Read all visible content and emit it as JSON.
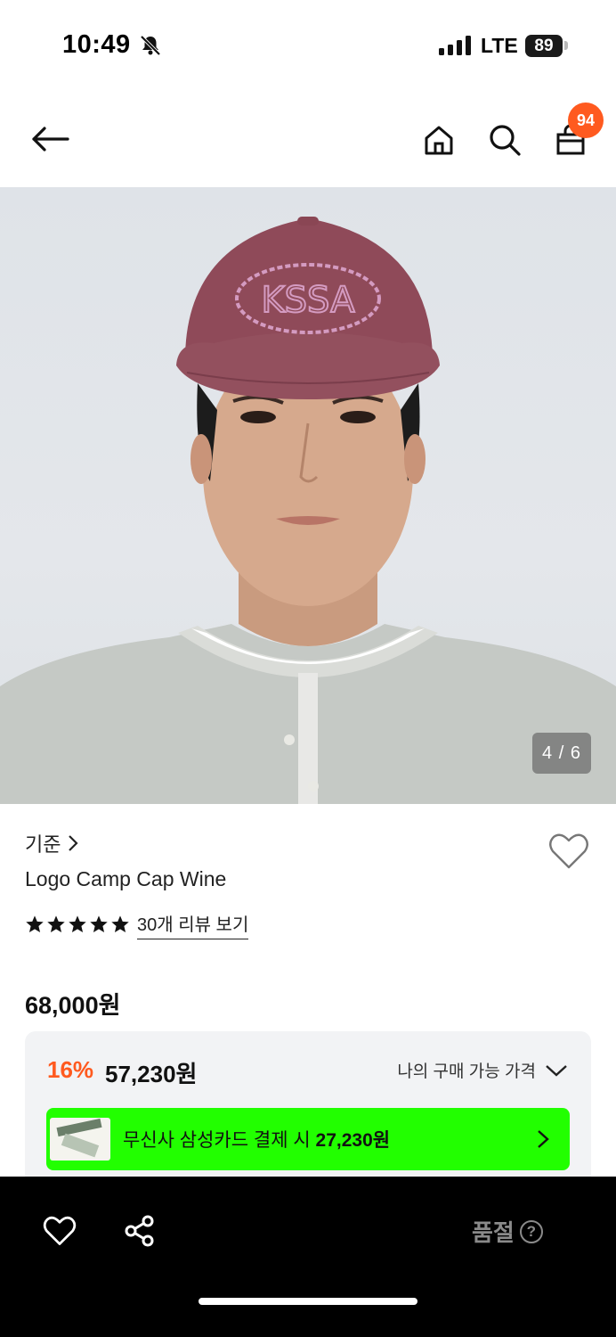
{
  "status_bar": {
    "time": "10:49",
    "network": "LTE",
    "battery": "89"
  },
  "header": {
    "cart_count": "94"
  },
  "gallery": {
    "counter": "4 / 6"
  },
  "product": {
    "brand": "기준",
    "name": "Logo Camp Cap Wine",
    "rating": 5,
    "review_link": "30개 리뷰 보기",
    "original_price": "68,000원"
  },
  "price_box": {
    "discount_rate": "16%",
    "sale_price": "57,230원",
    "my_price_label": "나의 구매 가능 가격",
    "card_banner": {
      "text": "무신사 삼성카드 결제 시",
      "price": "27,230원"
    }
  },
  "bottom_bar": {
    "status_label": "품절",
    "help_symbol": "?"
  },
  "colors": {
    "accent": "#ff5a1f",
    "card_banner": "#22ff00",
    "cap": "#8f4a59"
  }
}
